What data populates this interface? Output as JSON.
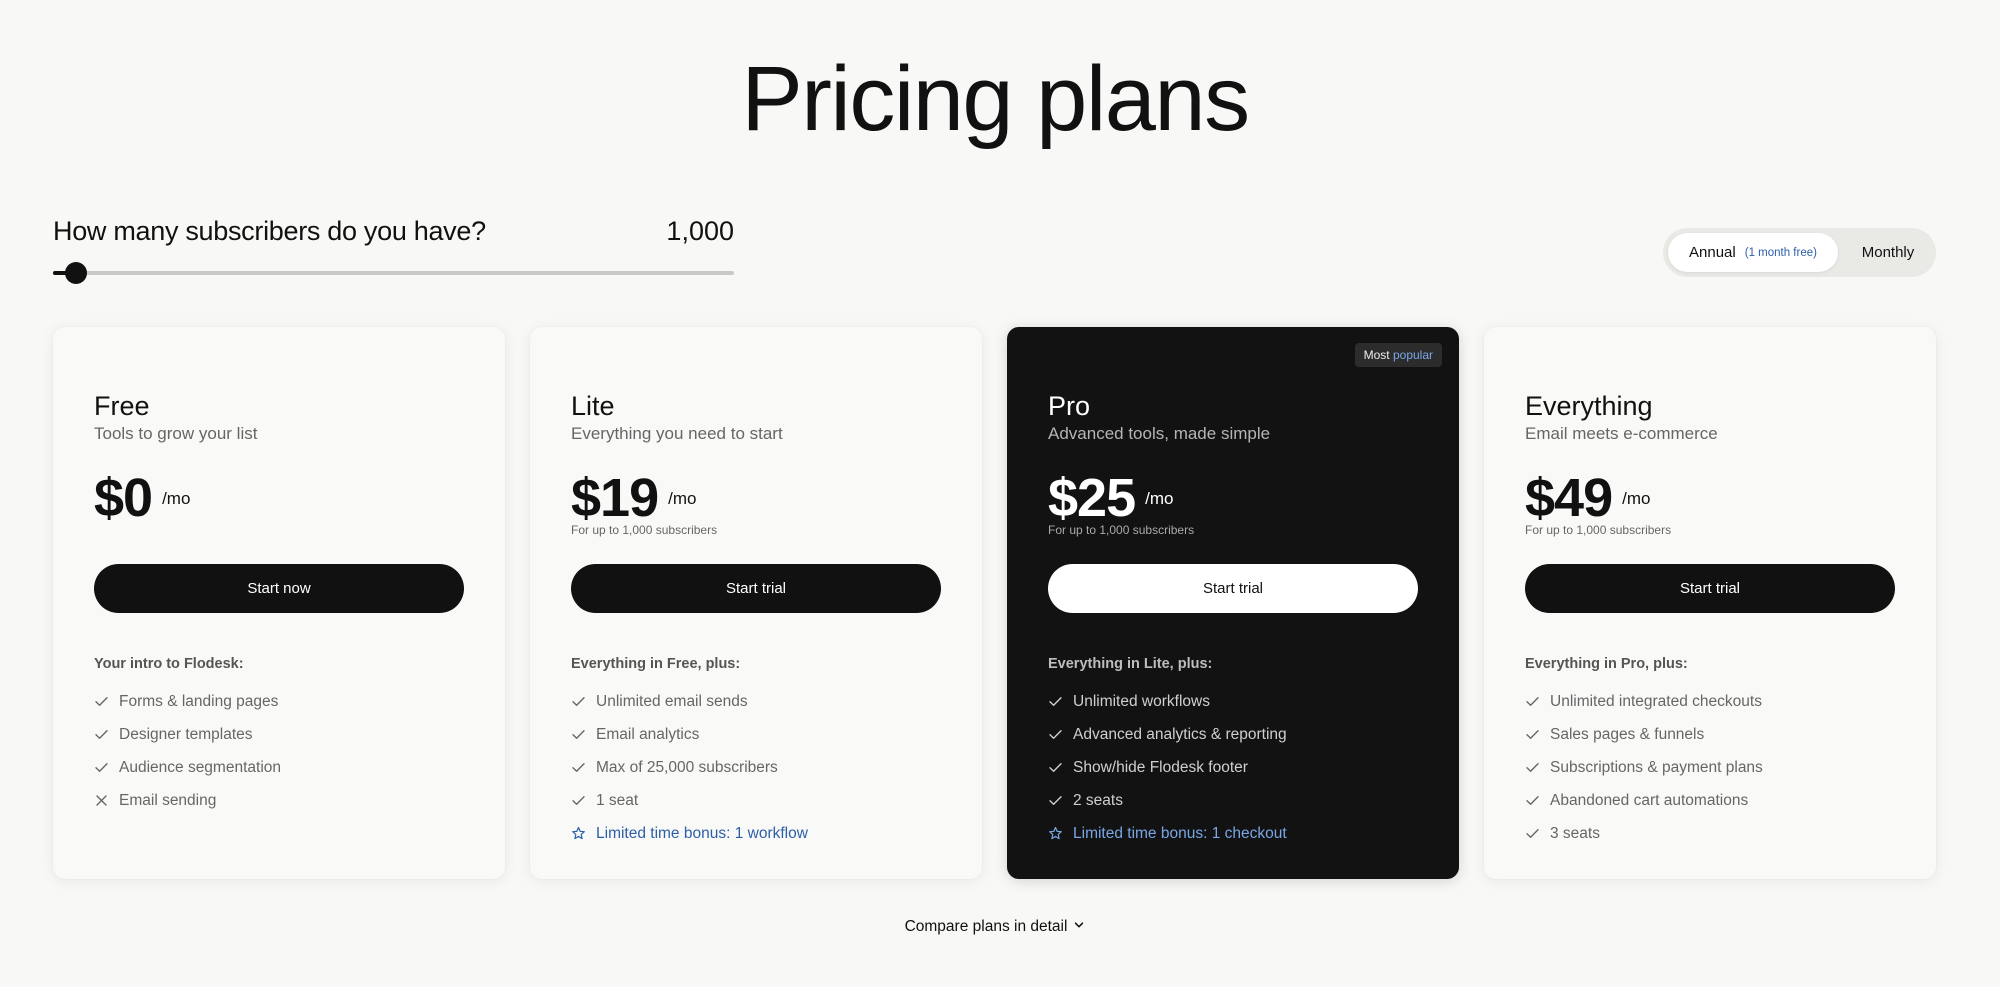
{
  "header": {
    "title": "Pricing plans"
  },
  "subscribers": {
    "question": "How many subscribers do you have?",
    "count": "1,000",
    "slider_fraction": 0.02
  },
  "billing": {
    "annual_label": "Annual",
    "annual_note": "(1 month free)",
    "monthly_label": "Monthly",
    "selected": "Annual"
  },
  "colors": {
    "accent_blue": "#2d5fa8",
    "accent_blue_light": "#7aa6e6",
    "dark_card": "#121212",
    "card": "#f9f9f7",
    "background": "#f8f8f6"
  },
  "plans": [
    {
      "name": "Free",
      "tagline": "Tools to grow your list",
      "price": "$0",
      "period": "/mo",
      "note": "",
      "cta": "Start now",
      "features_heading": "Your intro to Flodesk:",
      "features": [
        {
          "text": "Forms & landing pages",
          "icon": "check-icon"
        },
        {
          "text": "Designer templates",
          "icon": "check-icon"
        },
        {
          "text": "Audience segmentation",
          "icon": "check-icon"
        },
        {
          "text": "Email sending",
          "icon": "x-icon"
        }
      ]
    },
    {
      "name": "Lite",
      "tagline": "Everything you need to start",
      "price": "$19",
      "period": "/mo",
      "note": "For up to 1,000 subscribers",
      "cta": "Start trial",
      "features_heading": "Everything in Free, plus:",
      "features": [
        {
          "text": "Unlimited email sends",
          "icon": "check-icon"
        },
        {
          "text": "Email analytics",
          "icon": "check-icon"
        },
        {
          "text": "Max of 25,000 subscribers",
          "icon": "check-icon"
        },
        {
          "text": "1 seat",
          "icon": "check-icon"
        },
        {
          "text": "Limited time bonus: 1 workflow",
          "icon": "star-icon"
        }
      ]
    },
    {
      "name": "Pro",
      "tagline": "Advanced tools, made simple",
      "price": "$25",
      "period": "/mo",
      "note": "For up to 1,000 subscribers",
      "cta": "Start trial",
      "badge_prefix": "Most",
      "badge_accent": "popular",
      "features_heading": "Everything in Lite, plus:",
      "features": [
        {
          "text": "Unlimited workflows",
          "icon": "check-icon"
        },
        {
          "text": "Advanced analytics & reporting",
          "icon": "check-icon"
        },
        {
          "text": "Show/hide Flodesk footer",
          "icon": "check-icon"
        },
        {
          "text": "2 seats",
          "icon": "check-icon"
        },
        {
          "text": "Limited time bonus: 1 checkout",
          "icon": "star-icon"
        }
      ]
    },
    {
      "name": "Everything",
      "tagline": "Email meets e-commerce",
      "price": "$49",
      "period": "/mo",
      "note": "For up to 1,000 subscribers",
      "cta": "Start trial",
      "features_heading": "Everything in Pro, plus:",
      "features": [
        {
          "text": "Unlimited integrated checkouts",
          "icon": "check-icon"
        },
        {
          "text": "Sales pages & funnels",
          "icon": "check-icon"
        },
        {
          "text": "Subscriptions & payment plans",
          "icon": "check-icon"
        },
        {
          "text": "Abandoned cart automations",
          "icon": "check-icon"
        },
        {
          "text": "3 seats",
          "icon": "check-icon"
        }
      ]
    }
  ],
  "footer": {
    "compare_label": "Compare plans in detail"
  }
}
